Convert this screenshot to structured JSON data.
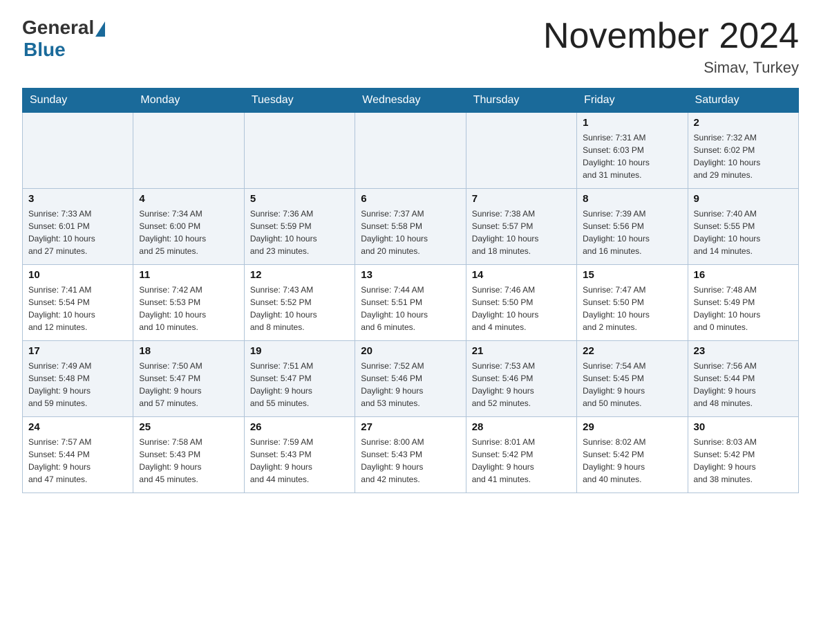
{
  "logo": {
    "general": "General",
    "blue": "Blue"
  },
  "title": "November 2024",
  "location": "Simav, Turkey",
  "weekdays": [
    "Sunday",
    "Monday",
    "Tuesday",
    "Wednesday",
    "Thursday",
    "Friday",
    "Saturday"
  ],
  "weeks": [
    [
      {
        "day": "",
        "info": ""
      },
      {
        "day": "",
        "info": ""
      },
      {
        "day": "",
        "info": ""
      },
      {
        "day": "",
        "info": ""
      },
      {
        "day": "",
        "info": ""
      },
      {
        "day": "1",
        "info": "Sunrise: 7:31 AM\nSunset: 6:03 PM\nDaylight: 10 hours\nand 31 minutes."
      },
      {
        "day": "2",
        "info": "Sunrise: 7:32 AM\nSunset: 6:02 PM\nDaylight: 10 hours\nand 29 minutes."
      }
    ],
    [
      {
        "day": "3",
        "info": "Sunrise: 7:33 AM\nSunset: 6:01 PM\nDaylight: 10 hours\nand 27 minutes."
      },
      {
        "day": "4",
        "info": "Sunrise: 7:34 AM\nSunset: 6:00 PM\nDaylight: 10 hours\nand 25 minutes."
      },
      {
        "day": "5",
        "info": "Sunrise: 7:36 AM\nSunset: 5:59 PM\nDaylight: 10 hours\nand 23 minutes."
      },
      {
        "day": "6",
        "info": "Sunrise: 7:37 AM\nSunset: 5:58 PM\nDaylight: 10 hours\nand 20 minutes."
      },
      {
        "day": "7",
        "info": "Sunrise: 7:38 AM\nSunset: 5:57 PM\nDaylight: 10 hours\nand 18 minutes."
      },
      {
        "day": "8",
        "info": "Sunrise: 7:39 AM\nSunset: 5:56 PM\nDaylight: 10 hours\nand 16 minutes."
      },
      {
        "day": "9",
        "info": "Sunrise: 7:40 AM\nSunset: 5:55 PM\nDaylight: 10 hours\nand 14 minutes."
      }
    ],
    [
      {
        "day": "10",
        "info": "Sunrise: 7:41 AM\nSunset: 5:54 PM\nDaylight: 10 hours\nand 12 minutes."
      },
      {
        "day": "11",
        "info": "Sunrise: 7:42 AM\nSunset: 5:53 PM\nDaylight: 10 hours\nand 10 minutes."
      },
      {
        "day": "12",
        "info": "Sunrise: 7:43 AM\nSunset: 5:52 PM\nDaylight: 10 hours\nand 8 minutes."
      },
      {
        "day": "13",
        "info": "Sunrise: 7:44 AM\nSunset: 5:51 PM\nDaylight: 10 hours\nand 6 minutes."
      },
      {
        "day": "14",
        "info": "Sunrise: 7:46 AM\nSunset: 5:50 PM\nDaylight: 10 hours\nand 4 minutes."
      },
      {
        "day": "15",
        "info": "Sunrise: 7:47 AM\nSunset: 5:50 PM\nDaylight: 10 hours\nand 2 minutes."
      },
      {
        "day": "16",
        "info": "Sunrise: 7:48 AM\nSunset: 5:49 PM\nDaylight: 10 hours\nand 0 minutes."
      }
    ],
    [
      {
        "day": "17",
        "info": "Sunrise: 7:49 AM\nSunset: 5:48 PM\nDaylight: 9 hours\nand 59 minutes."
      },
      {
        "day": "18",
        "info": "Sunrise: 7:50 AM\nSunset: 5:47 PM\nDaylight: 9 hours\nand 57 minutes."
      },
      {
        "day": "19",
        "info": "Sunrise: 7:51 AM\nSunset: 5:47 PM\nDaylight: 9 hours\nand 55 minutes."
      },
      {
        "day": "20",
        "info": "Sunrise: 7:52 AM\nSunset: 5:46 PM\nDaylight: 9 hours\nand 53 minutes."
      },
      {
        "day": "21",
        "info": "Sunrise: 7:53 AM\nSunset: 5:46 PM\nDaylight: 9 hours\nand 52 minutes."
      },
      {
        "day": "22",
        "info": "Sunrise: 7:54 AM\nSunset: 5:45 PM\nDaylight: 9 hours\nand 50 minutes."
      },
      {
        "day": "23",
        "info": "Sunrise: 7:56 AM\nSunset: 5:44 PM\nDaylight: 9 hours\nand 48 minutes."
      }
    ],
    [
      {
        "day": "24",
        "info": "Sunrise: 7:57 AM\nSunset: 5:44 PM\nDaylight: 9 hours\nand 47 minutes."
      },
      {
        "day": "25",
        "info": "Sunrise: 7:58 AM\nSunset: 5:43 PM\nDaylight: 9 hours\nand 45 minutes."
      },
      {
        "day": "26",
        "info": "Sunrise: 7:59 AM\nSunset: 5:43 PM\nDaylight: 9 hours\nand 44 minutes."
      },
      {
        "day": "27",
        "info": "Sunrise: 8:00 AM\nSunset: 5:43 PM\nDaylight: 9 hours\nand 42 minutes."
      },
      {
        "day": "28",
        "info": "Sunrise: 8:01 AM\nSunset: 5:42 PM\nDaylight: 9 hours\nand 41 minutes."
      },
      {
        "day": "29",
        "info": "Sunrise: 8:02 AM\nSunset: 5:42 PM\nDaylight: 9 hours\nand 40 minutes."
      },
      {
        "day": "30",
        "info": "Sunrise: 8:03 AM\nSunset: 5:42 PM\nDaylight: 9 hours\nand 38 minutes."
      }
    ]
  ]
}
